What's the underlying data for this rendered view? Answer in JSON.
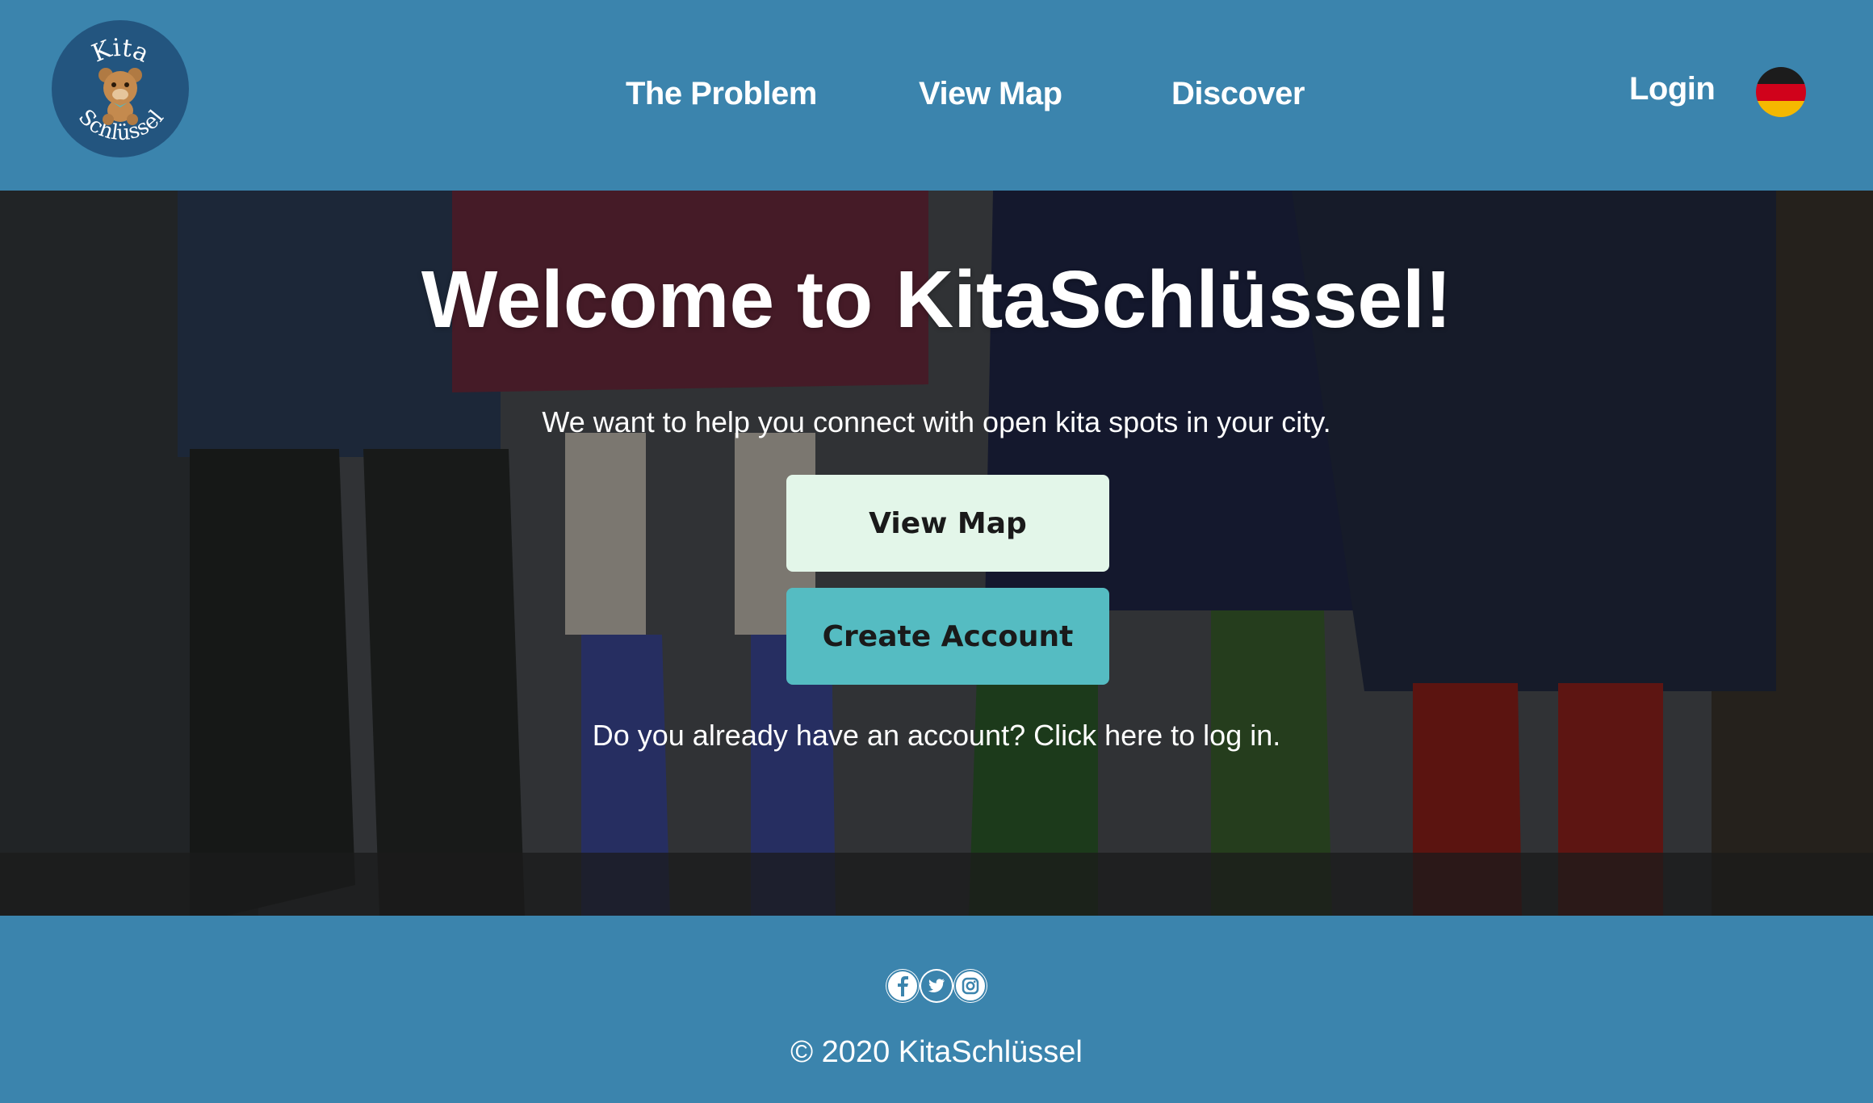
{
  "brand": {
    "logo_top_text": "Kita",
    "logo_bottom_text": "Schlüssel",
    "logo_color": "#23557f"
  },
  "nav": {
    "items": [
      {
        "label": "The Problem"
      },
      {
        "label": "View Map"
      },
      {
        "label": "Discover"
      }
    ],
    "login_label": "Login",
    "language_flag": "german-flag-icon"
  },
  "hero": {
    "title": "Welcome to KitaSchlüssel!",
    "subtitle": "We want to help you connect with open kita spots in your city.",
    "view_map_label": "View Map",
    "create_account_label": "Create Account",
    "login_prompt": "Do you already have an account? Click here to log in."
  },
  "footer": {
    "social_icons": [
      "facebook-icon",
      "twitter-icon",
      "instagram-icon"
    ],
    "copyright": "© 2020 KitaSchlüssel"
  },
  "colors": {
    "primary": "#3b84ad",
    "view_map_button": "#e3f6e9",
    "create_account_button": "#55bcc2"
  }
}
